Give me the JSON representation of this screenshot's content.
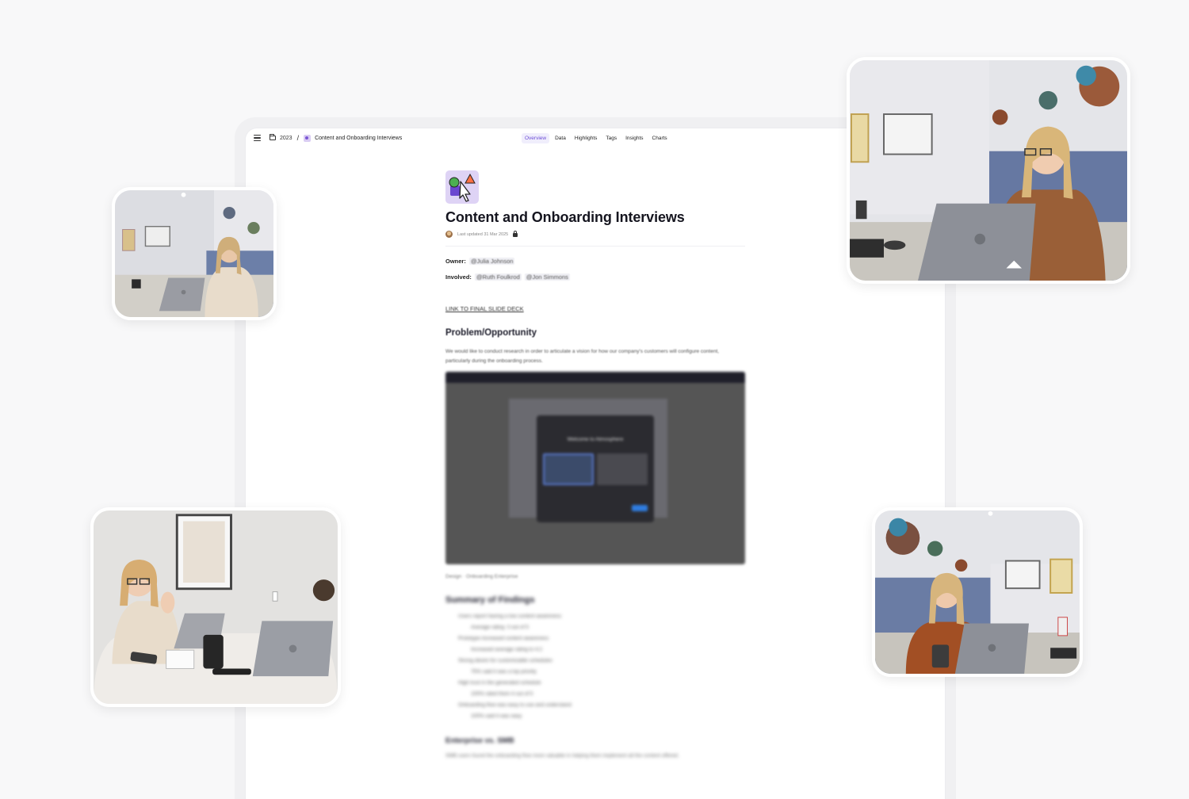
{
  "window": {
    "breadcrumb": {
      "year": "2023",
      "separator": "/",
      "project": "Content and Onboarding Interviews"
    },
    "tabs": [
      {
        "label": "Overview",
        "active": true
      },
      {
        "label": "Data",
        "active": false
      },
      {
        "label": "Highlights",
        "active": false
      },
      {
        "label": "Tags",
        "active": false
      },
      {
        "label": "Insights",
        "active": false
      },
      {
        "label": "Charts",
        "active": false
      }
    ]
  },
  "document": {
    "title": "Content and Onboarding Interviews",
    "last_updated": "Last updated 31 Mar 2025",
    "owner_label": "Owner:",
    "owner": "@Julia Johnson",
    "involved_label": "Involved:",
    "involved": [
      "@Ruth Foulkrod",
      "@Jon Simmons"
    ],
    "slide_deck_link": "LINK TO FINAL SLIDE DECK",
    "problem_heading": "Problem/Opportunity",
    "problem_text": "We would like to conduct research in order to articulate a vision for how our company's customers will configure content, particularly during the onboarding process.",
    "screenshot_modal_title": "Welcome to Atmosphere",
    "screenshot_caption": "Design · Onboarding Enterprise",
    "summary_heading": "Summary of Findings",
    "findings": [
      {
        "text": "Users report having a low content awareness",
        "sub": false
      },
      {
        "text": "Average rating: 3 out of 5",
        "sub": true
      },
      {
        "text": "Prototype increased content awareness",
        "sub": false
      },
      {
        "text": "Increased average rating to 4.2",
        "sub": true
      },
      {
        "text": "Strong desire for customizable schedules",
        "sub": false
      },
      {
        "text": "75% said it was a top priority",
        "sub": true
      },
      {
        "text": "High trust in the generated schedule",
        "sub": false
      },
      {
        "text": "100% rated them 4 out of 5",
        "sub": true
      },
      {
        "text": "Onboarding flow was easy to use and understand",
        "sub": false
      },
      {
        "text": "100% said it was easy",
        "sub": true
      }
    ],
    "enterprise_heading": "Enterprise vs. SMB",
    "enterprise_text": "SMB users found the onboarding flow more valuable in helping them implement all the content offered."
  },
  "colors": {
    "accent": "#6c4dd6",
    "accent_bg": "#f0eefc",
    "page_bg": "#f8f8f9"
  },
  "icons": [
    "menu-icon",
    "folder-icon",
    "project-icon",
    "lock-icon"
  ],
  "videos": [
    {
      "name": "participant-video-top-left"
    },
    {
      "name": "participant-video-top-right"
    },
    {
      "name": "participant-video-bottom-left"
    },
    {
      "name": "participant-video-bottom-right"
    }
  ]
}
